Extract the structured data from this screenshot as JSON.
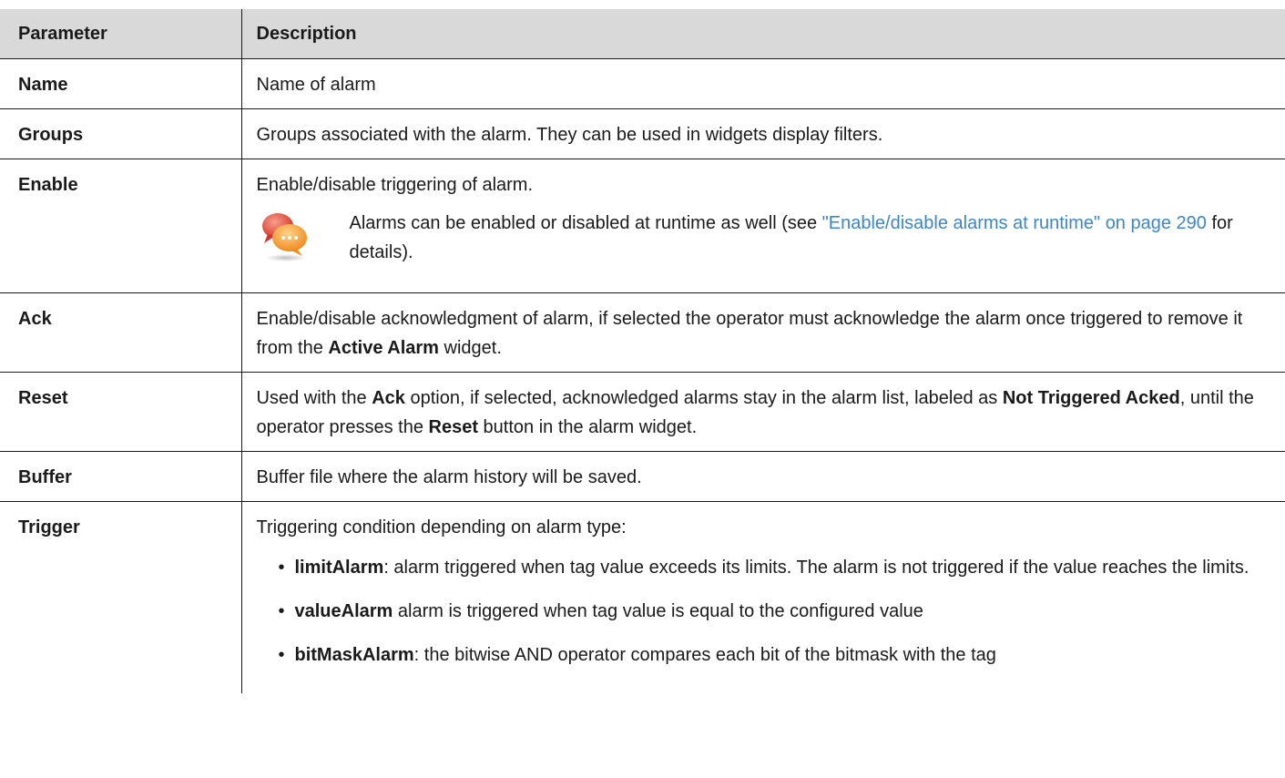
{
  "header": {
    "param_label": "Parameter",
    "desc_label": "Description"
  },
  "rows": {
    "name": {
      "param": "Name",
      "desc": "Name of alarm"
    },
    "groups": {
      "param": "Groups",
      "desc": "Groups associated with the alarm. They can be used in widgets display filters."
    },
    "enable": {
      "param": "Enable",
      "desc": "Enable/disable triggering of alarm.",
      "note": {
        "icon": "speech-bubbles-icon",
        "text_before": "Alarms can be enabled or disabled at runtime as well (see ",
        "link": "\"Enable/disable alarms at runtime\" on page 290",
        "text_after": " for details)."
      }
    },
    "ack": {
      "param": "Ack",
      "desc_1": "Enable/disable acknowledgment of alarm, if selected the operator must acknowledge the alarm once triggered to remove it from the ",
      "desc_bold": "Active Alarm",
      "desc_2": " widget."
    },
    "reset": {
      "param": "Reset",
      "desc_1": "Used with the ",
      "desc_bold_1": "Ack",
      "desc_2": " option, if selected, acknowledged alarms stay in the alarm list, labeled as ",
      "desc_bold_2": "Not Triggered Acked",
      "desc_3": ", until the operator presses the ",
      "desc_bold_3": "Reset",
      "desc_4": " button in the alarm widget."
    },
    "buffer": {
      "param": "Buffer",
      "desc": "Buffer file where the alarm history will be saved."
    },
    "trigger": {
      "param": "Trigger",
      "desc": "Triggering condition depending on alarm type:",
      "items": [
        {
          "term": "limitAlarm",
          "text": ": alarm triggered when tag value exceeds its limits. The alarm is not triggered if the value reaches the limits."
        },
        {
          "term": "valueAlarm",
          "text": " alarm is triggered when tag value is equal to the configured value"
        },
        {
          "term": "bitMaskAlarm",
          "text": ": the bitwise AND operator compares each bit of the bitmask with the tag"
        }
      ]
    }
  },
  "colors": {
    "header_bg": "#d9d9d9",
    "link": "#3b87c7",
    "text": "#1a1a1a"
  }
}
